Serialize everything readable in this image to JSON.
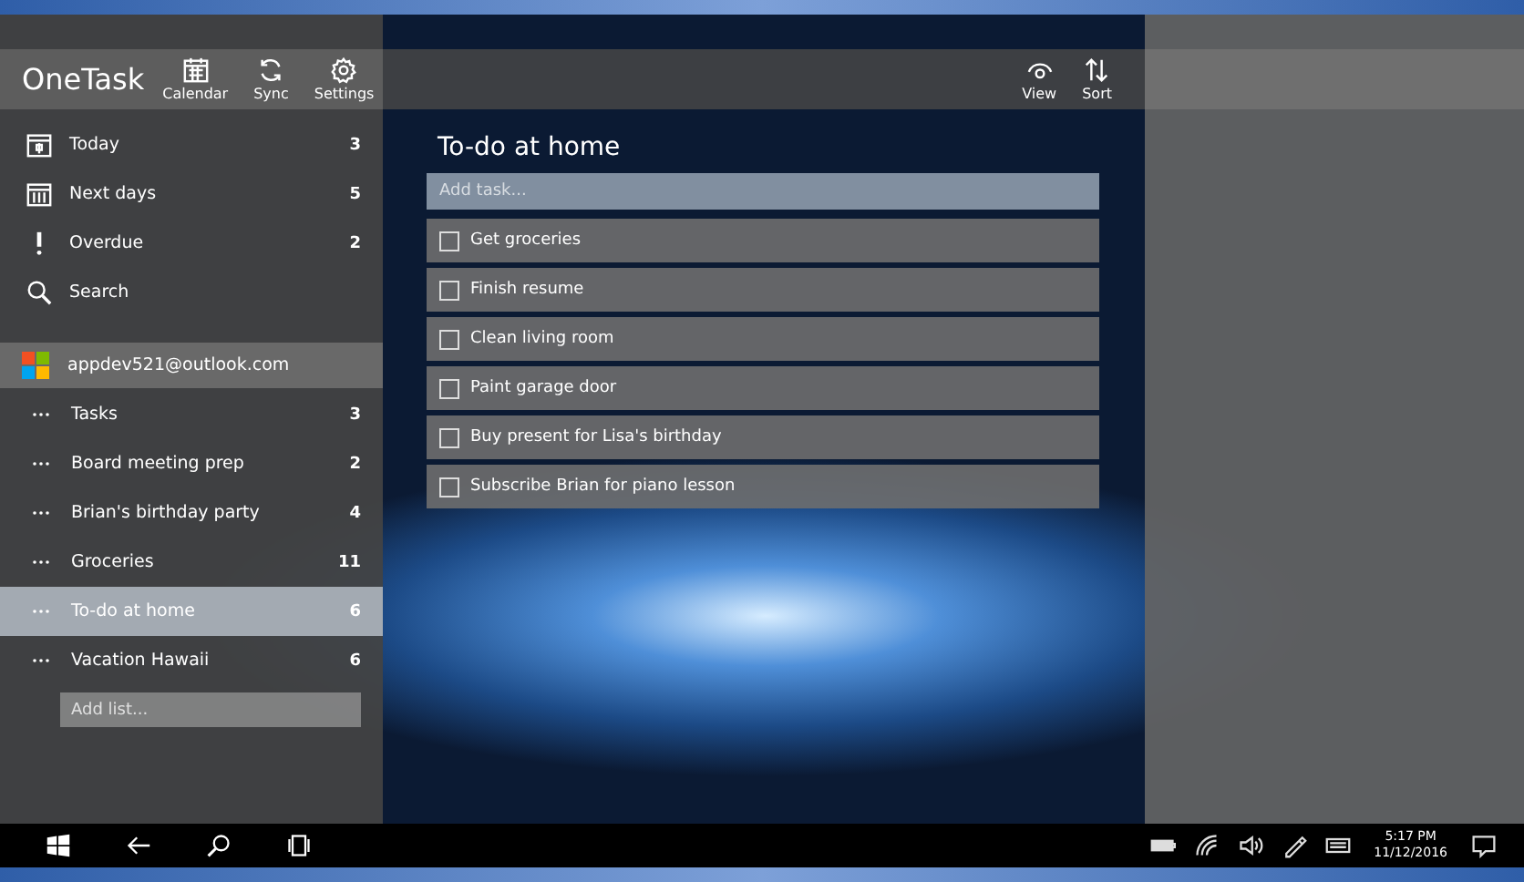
{
  "app": {
    "title": "OneTask"
  },
  "toolbar": [
    {
      "kind": "calendar",
      "label": "Calendar"
    },
    {
      "kind": "sync",
      "label": "Sync"
    },
    {
      "kind": "settings",
      "label": "Settings"
    }
  ],
  "nav": [
    {
      "kind": "today",
      "label": "Today",
      "count": "3"
    },
    {
      "kind": "next",
      "label": "Next days",
      "count": "5"
    },
    {
      "kind": "overdue",
      "label": "Overdue",
      "count": "2"
    },
    {
      "kind": "search",
      "label": "Search"
    }
  ],
  "account": {
    "email": "appdev521@outlook.com"
  },
  "lists": [
    {
      "label": "Tasks",
      "count": "3",
      "selected": false
    },
    {
      "label": "Board meeting prep",
      "count": "2",
      "selected": false
    },
    {
      "label": "Brian's birthday party",
      "count": "4",
      "selected": false
    },
    {
      "label": "Groceries",
      "count": "11",
      "selected": false
    },
    {
      "label": "To-do at home",
      "count": "6",
      "selected": true
    },
    {
      "label": "Vacation Hawaii",
      "count": "6",
      "selected": false
    }
  ],
  "add_list": {
    "placeholder": "Add list..."
  },
  "content": {
    "title": "To-do at home",
    "add_task": {
      "placeholder": "Add task..."
    },
    "toolbar": [
      {
        "kind": "view",
        "label": "View"
      },
      {
        "kind": "sort",
        "label": "Sort"
      }
    ],
    "tasks": [
      {
        "label": "Get groceries",
        "checked": false
      },
      {
        "label": "Finish resume",
        "checked": false
      },
      {
        "label": "Clean living room",
        "checked": false
      },
      {
        "label": "Paint garage door",
        "checked": false
      },
      {
        "label": "Buy present for Lisa's birthday",
        "checked": false
      },
      {
        "label": "Subscribe Brian for piano lesson",
        "checked": false
      }
    ]
  },
  "taskbar": {
    "time": "5:17 PM",
    "date": "11/12/2016"
  }
}
